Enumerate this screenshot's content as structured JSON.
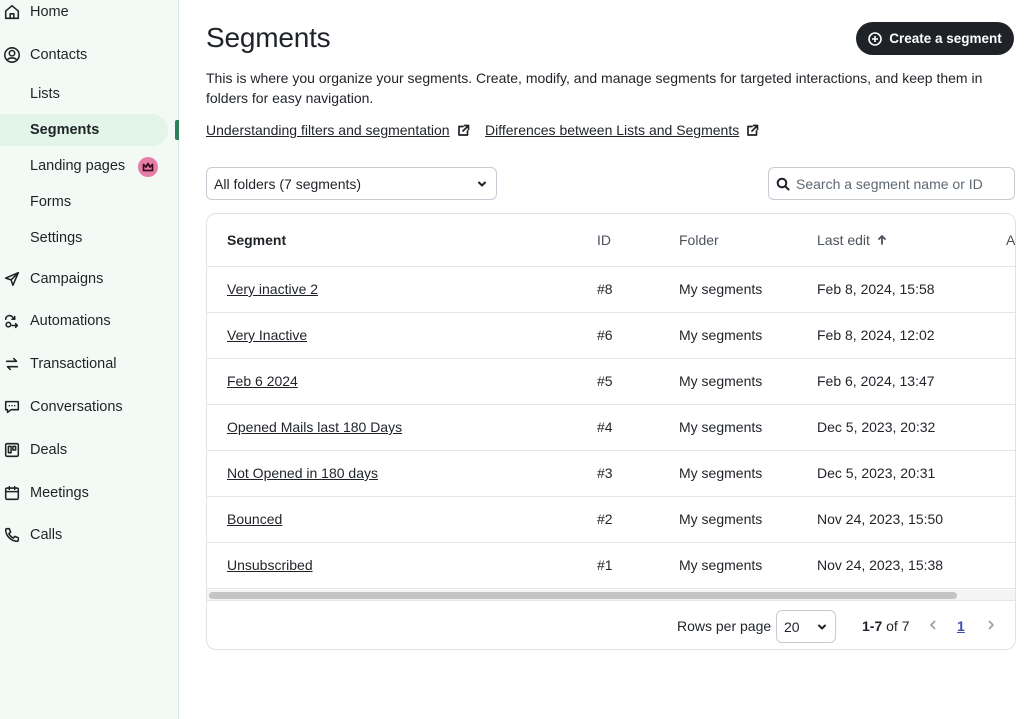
{
  "sidebar": {
    "items": [
      {
        "label": "Home",
        "icon": "home-icon"
      },
      {
        "label": "Contacts",
        "icon": "contacts-icon"
      },
      {
        "label": "Campaigns",
        "icon": "send-icon"
      },
      {
        "label": "Automations",
        "icon": "automation-icon"
      },
      {
        "label": "Transactional",
        "icon": "transfer-icon"
      },
      {
        "label": "Conversations",
        "icon": "chat-icon"
      },
      {
        "label": "Deals",
        "icon": "deals-icon"
      },
      {
        "label": "Meetings",
        "icon": "calendar-icon"
      },
      {
        "label": "Calls",
        "icon": "phone-icon"
      }
    ],
    "contacts_sub": [
      {
        "label": "Lists"
      },
      {
        "label": "Segments",
        "active": true
      },
      {
        "label": "Landing pages",
        "badge_icon": "crown-icon"
      },
      {
        "label": "Forms"
      },
      {
        "label": "Settings"
      }
    ]
  },
  "header": {
    "title": "Segments",
    "create_button": "Create a segment",
    "description": "This is where you organize your segments. Create, modify, and manage segments for targeted interactions, and keep them in folders for easy navigation.",
    "links": [
      "Understanding filters and segmentation",
      "Differences between Lists and Segments"
    ]
  },
  "filters": {
    "folder_value": "All folders (7 segments)",
    "search_placeholder": "Search a segment name or ID"
  },
  "table": {
    "columns": [
      "Segment",
      "ID",
      "Folder",
      "Last edit",
      "A"
    ],
    "sort_icon": "arrow-up-icon",
    "rows": [
      {
        "name": "Very inactive 2",
        "id": "#8",
        "folder": "My segments",
        "last_edit": "Feb 8, 2024, 15:58"
      },
      {
        "name": "Very Inactive",
        "id": "#6",
        "folder": "My segments",
        "last_edit": "Feb 8, 2024, 12:02"
      },
      {
        "name": "Feb 6 2024",
        "id": "#5",
        "folder": "My segments",
        "last_edit": "Feb 6, 2024, 13:47"
      },
      {
        "name": "Opened Mails last 180 Days",
        "id": "#4",
        "folder": "My segments",
        "last_edit": "Dec 5, 2023, 20:32"
      },
      {
        "name": "Not Opened in 180 days",
        "id": "#3",
        "folder": "My segments",
        "last_edit": "Dec 5, 2023, 20:31"
      },
      {
        "name": "Bounced",
        "id": "#2",
        "folder": "My segments",
        "last_edit": "Nov 24, 2023, 15:50"
      },
      {
        "name": "Unsubscribed",
        "id": "#1",
        "folder": "My segments",
        "last_edit": "Nov 24, 2023, 15:38"
      }
    ]
  },
  "pagination": {
    "rows_label": "Rows per page",
    "rows_value": "20",
    "range_bold": "1-7",
    "range_rest": " of 7",
    "current_page": "1"
  },
  "colors": {
    "sidebar_bg": "#f3faf5",
    "active_marker": "#2e7d5b",
    "primary_button": "#1f2328",
    "badge": "#e87ea8"
  }
}
